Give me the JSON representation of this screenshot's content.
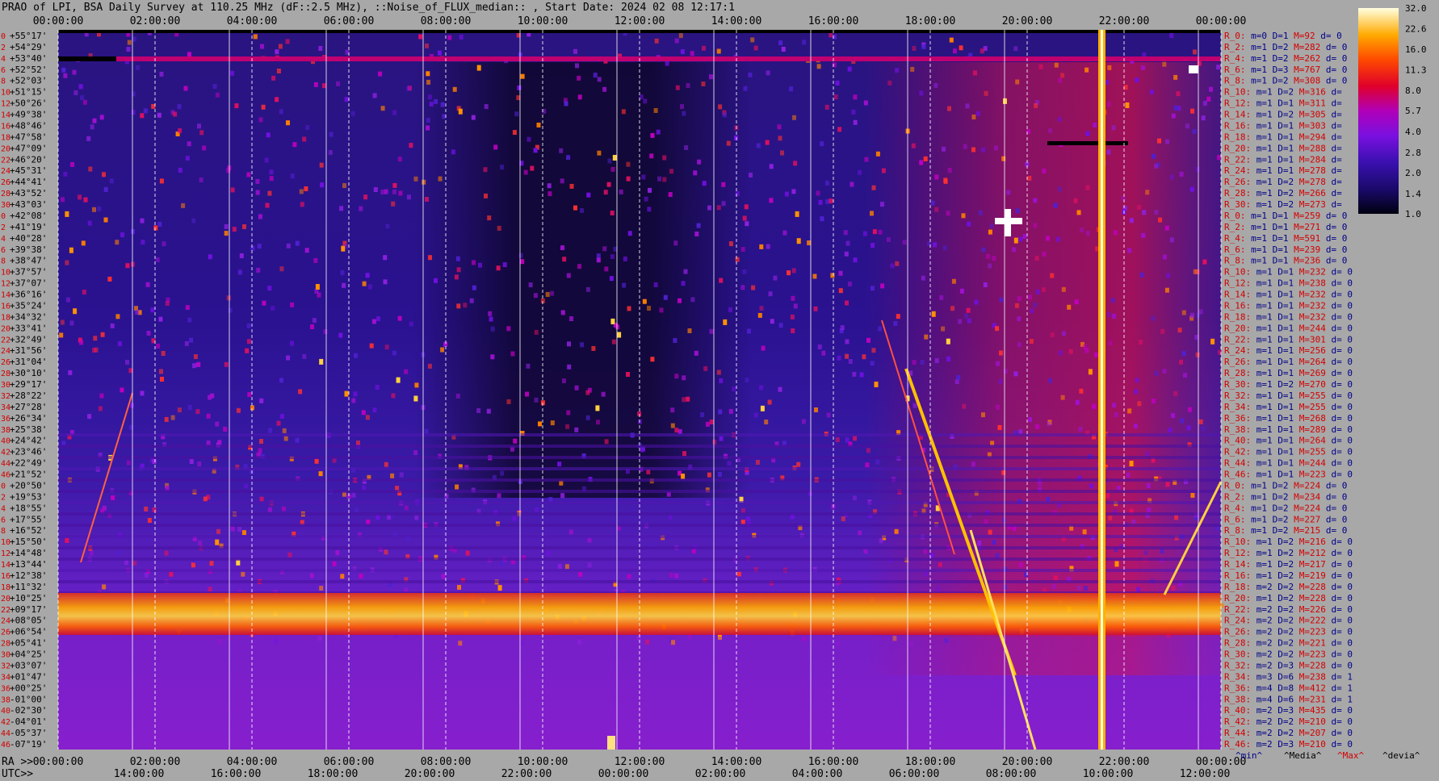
{
  "title": "PRAO of LPI, BSA Daily Survey at 110.25 MHz (dF::2.5 MHz), ::Noise_of_FLUX_median:: , Start Date: 2024 02 08 12:17:1",
  "chart_data": {
    "type": "heatmap",
    "title": "PRAO of LPI, BSA Daily Survey at 110.25 MHz (dF::2.5 MHz), ::Noise_of_FLUX_median:: , Start Date: 2024 02 08 12:17:1",
    "x_top_ticks": [
      "00:00:00",
      "02:00:00",
      "04:00:00",
      "06:00:00",
      "08:00:00",
      "10:00:00",
      "12:00:00",
      "14:00:00",
      "16:00:00",
      "18:00:00",
      "20:00:00",
      "22:00:00",
      "00:00:00"
    ],
    "ra_axis_label": "RA >>",
    "ra_ticks": [
      "00:00:00",
      "02:00:00",
      "04:00:00",
      "06:00:00",
      "08:00:00",
      "10:00:00",
      "12:00:00",
      "14:00:00",
      "16:00:00",
      "18:00:00",
      "20:00:00",
      "22:00:00",
      "00:00:00"
    ],
    "utc_axis_label": "UTC>>",
    "utc_ticks": [
      "14:00:00",
      "16:00:00",
      "18:00:00",
      "20:00:00",
      "22:00:00",
      "00:00:00",
      "02:00:00",
      "04:00:00",
      "06:00:00",
      "08:00:00",
      "10:00:00",
      "12:00:00"
    ],
    "dec_labels": [
      "+55°17'",
      "+54°29'",
      "+53°40'",
      "+52°52'",
      "+52°03'",
      "+51°15'",
      "+50°26'",
      "+49°38'",
      "+48°46'",
      "+47°58'",
      "+47°09'",
      "+46°20'",
      "+45°31'",
      "+44°41'",
      "+43°52'",
      "+43°03'",
      "+42°08'",
      "+41°19'",
      "+40°28'",
      "+39°38'",
      "+38°47'",
      "+37°57'",
      "+37°07'",
      "+36°16'",
      "+35°24'",
      "+34°32'",
      "+33°41'",
      "+32°49'",
      "+31°56'",
      "+31°04'",
      "+30°10'",
      "+29°17'",
      "+28°22'",
      "+27°28'",
      "+26°34'",
      "+25°38'",
      "+24°42'",
      "+23°46'",
      "+22°49'",
      "+21°52'",
      "+20°50'",
      "+19°53'",
      "+18°55'",
      "+17°55'",
      "+16°52'",
      "+15°50'",
      "+14°48'",
      "+13°44'",
      "+12°38'",
      "+11°32'",
      "+10°25'",
      "+09°17'",
      "+08°05'",
      "+06°54'",
      "+05°41'",
      "+04°25'",
      "+03°07'",
      "+01°47'",
      "+00°25'",
      "-01°00'",
      "-02°30'",
      "-04°01'",
      "-05°37'",
      "-07°19'"
    ],
    "colorbar_ticks": [
      "32.0",
      "22.6",
      "16.0",
      "11.3",
      "8.0",
      "5.7",
      "4.0",
      "2.8",
      "2.0",
      "1.4",
      "1.0"
    ],
    "colorbar_range": [
      1.0,
      32.0
    ],
    "colorbar_scale": "log2",
    "stats_header": [
      "^min^",
      "^Media^",
      "^Max^",
      "^devia^"
    ],
    "stats": [
      [
        "R_0:",
        "m=0",
        "D=1",
        "M=92",
        "d= 0"
      ],
      [
        "R_2:",
        "m=1",
        "D=2",
        "M=282",
        "d= 0"
      ],
      [
        "R_4:",
        "m=1",
        "D=2",
        "M=262",
        "d= 0"
      ],
      [
        "R_6:",
        "m=1",
        "D=3",
        "M=767",
        "d= 0"
      ],
      [
        "R_8:",
        "m=1",
        "D=2",
        "M=308",
        "d= 0"
      ],
      [
        "R_10:",
        "m=1",
        "D=2",
        "M=316",
        "d= "
      ],
      [
        "R_12:",
        "m=1",
        "D=1",
        "M=311",
        "d= "
      ],
      [
        "R_14:",
        "m=1",
        "D=2",
        "M=305",
        "d= "
      ],
      [
        "R_16:",
        "m=1",
        "D=1",
        "M=303",
        "d= "
      ],
      [
        "R_18:",
        "m=1",
        "D=1",
        "M=294",
        "d= "
      ],
      [
        "R_20:",
        "m=1",
        "D=1",
        "M=288",
        "d= "
      ],
      [
        "R_22:",
        "m=1",
        "D=1",
        "M=284",
        "d= "
      ],
      [
        "R_24:",
        "m=1",
        "D=1",
        "M=278",
        "d= "
      ],
      [
        "R_26:",
        "m=1",
        "D=2",
        "M=278",
        "d= "
      ],
      [
        "R_28:",
        "m=1",
        "D=2",
        "M=266",
        "d= "
      ],
      [
        "R_30:",
        "m=1",
        "D=2",
        "M=273",
        "d= "
      ],
      [
        "R_0:",
        "m=1",
        "D=1",
        "M=259",
        "d= 0"
      ],
      [
        "R_2:",
        "m=1",
        "D=1",
        "M=271",
        "d= 0"
      ],
      [
        "R_4:",
        "m=1",
        "D=1",
        "M=591",
        "d= 0"
      ],
      [
        "R_6:",
        "m=1",
        "D=1",
        "M=239",
        "d= 0"
      ],
      [
        "R_8:",
        "m=1",
        "D=1",
        "M=236",
        "d= 0"
      ],
      [
        "R_10:",
        "m=1",
        "D=1",
        "M=232",
        "d= 0"
      ],
      [
        "R_12:",
        "m=1",
        "D=1",
        "M=238",
        "d= 0"
      ],
      [
        "R_14:",
        "m=1",
        "D=1",
        "M=232",
        "d= 0"
      ],
      [
        "R_16:",
        "m=1",
        "D=1",
        "M=232",
        "d= 0"
      ],
      [
        "R_18:",
        "m=1",
        "D=1",
        "M=232",
        "d= 0"
      ],
      [
        "R_20:",
        "m=1",
        "D=1",
        "M=244",
        "d= 0"
      ],
      [
        "R_22:",
        "m=1",
        "D=1",
        "M=301",
        "d= 0"
      ],
      [
        "R_24:",
        "m=1",
        "D=1",
        "M=256",
        "d= 0"
      ],
      [
        "R_26:",
        "m=1",
        "D=1",
        "M=264",
        "d= 0"
      ],
      [
        "R_28:",
        "m=1",
        "D=1",
        "M=269",
        "d= 0"
      ],
      [
        "R_30:",
        "m=1",
        "D=2",
        "M=270",
        "d= 0"
      ],
      [
        "R_32:",
        "m=1",
        "D=1",
        "M=255",
        "d= 0"
      ],
      [
        "R_34:",
        "m=1",
        "D=1",
        "M=255",
        "d= 0"
      ],
      [
        "R_36:",
        "m=1",
        "D=1",
        "M=268",
        "d= 0"
      ],
      [
        "R_38:",
        "m=1",
        "D=1",
        "M=289",
        "d= 0"
      ],
      [
        "R_40:",
        "m=1",
        "D=1",
        "M=264",
        "d= 0"
      ],
      [
        "R_42:",
        "m=1",
        "D=1",
        "M=255",
        "d= 0"
      ],
      [
        "R_44:",
        "m=1",
        "D=1",
        "M=244",
        "d= 0"
      ],
      [
        "R_46:",
        "m=1",
        "D=1",
        "M=223",
        "d= 0"
      ],
      [
        "R_0:",
        "m=1",
        "D=2",
        "M=224",
        "d= 0"
      ],
      [
        "R_2:",
        "m=1",
        "D=2",
        "M=234",
        "d= 0"
      ],
      [
        "R_4:",
        "m=1",
        "D=2",
        "M=224",
        "d= 0"
      ],
      [
        "R_6:",
        "m=1",
        "D=2",
        "M=227",
        "d= 0"
      ],
      [
        "R_8:",
        "m=1",
        "D=2",
        "M=215",
        "d= 0"
      ],
      [
        "R_10:",
        "m=1",
        "D=2",
        "M=216",
        "d= 0"
      ],
      [
        "R_12:",
        "m=1",
        "D=2",
        "M=212",
        "d= 0"
      ],
      [
        "R_14:",
        "m=1",
        "D=2",
        "M=217",
        "d= 0"
      ],
      [
        "R_16:",
        "m=1",
        "D=2",
        "M=219",
        "d= 0"
      ],
      [
        "R_18:",
        "m=2",
        "D=2",
        "M=228",
        "d= 0"
      ],
      [
        "R_20:",
        "m=1",
        "D=2",
        "M=228",
        "d= 0"
      ],
      [
        "R_22:",
        "m=2",
        "D=2",
        "M=226",
        "d= 0"
      ],
      [
        "R_24:",
        "m=2",
        "D=2",
        "M=222",
        "d= 0"
      ],
      [
        "R_26:",
        "m=2",
        "D=2",
        "M=223",
        "d= 0"
      ],
      [
        "R_28:",
        "m=2",
        "D=2",
        "M=221",
        "d= 0"
      ],
      [
        "R_30:",
        "m=2",
        "D=2",
        "M=223",
        "d= 0"
      ],
      [
        "R_32:",
        "m=2",
        "D=3",
        "M=228",
        "d= 0"
      ],
      [
        "R_34:",
        "m=3",
        "D=6",
        "M=238",
        "d= 1"
      ],
      [
        "R_36:",
        "m=4",
        "D=8",
        "M=412",
        "d= 1"
      ],
      [
        "R_38:",
        "m=4",
        "D=6",
        "M=231",
        "d= 1"
      ],
      [
        "R_40:",
        "m=2",
        "D=3",
        "M=435",
        "d= 0"
      ],
      [
        "R_42:",
        "m=2",
        "D=2",
        "M=210",
        "d= 0"
      ],
      [
        "R_44:",
        "m=2",
        "D=2",
        "M=207",
        "d= 0"
      ],
      [
        "R_46:",
        "m=2",
        "D=3",
        "M=210",
        "d= 0"
      ]
    ],
    "left_index": [
      "0",
      "2",
      "4",
      "6",
      "8",
      "10",
      "12",
      "14",
      "16",
      "18",
      "20",
      "22",
      "24",
      "26",
      "28",
      "30",
      "0",
      "2",
      "4",
      "6",
      "8",
      "10",
      "12",
      "14",
      "16",
      "18",
      "20",
      "22",
      "24",
      "26",
      "28",
      "30",
      "32",
      "34",
      "36",
      "38",
      "40",
      "42",
      "44",
      "46",
      "0",
      "2",
      "4",
      "6",
      "8",
      "10",
      "12",
      "14",
      "16",
      "18",
      "20",
      "22",
      "24",
      "26",
      "28",
      "30",
      "32",
      "34",
      "36",
      "38",
      "40",
      "42",
      "44",
      "46"
    ]
  },
  "colors": {
    "background": "#a8a8a8",
    "stat_label": "#d40000",
    "stat_value": "#000088",
    "stat_max": "#d40000",
    "axis_text": "#000000",
    "grid_solid": "#ffffff",
    "grid_dashed": "#ffffff"
  }
}
